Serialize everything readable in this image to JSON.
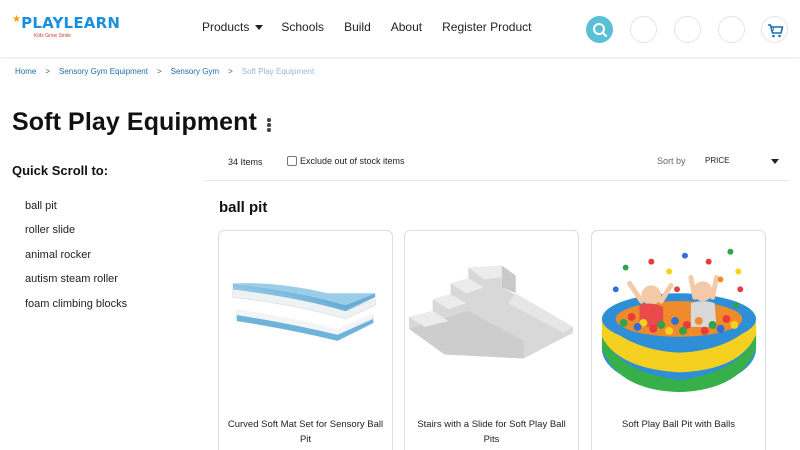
{
  "brand": {
    "name": "PLAYLEARN",
    "tagline": "Kids Grow Smile",
    "accent": "#1a8fdf",
    "search_color": "#5bbfd6"
  },
  "nav": {
    "items": [
      {
        "label": "Products",
        "has_dropdown": true
      },
      {
        "label": "Schools"
      },
      {
        "label": "Build"
      },
      {
        "label": "About"
      },
      {
        "label": "Register Product"
      }
    ]
  },
  "header_icons": [
    "search-icon",
    "account-icon",
    "wishlist-icon",
    "compare-icon",
    "cart-icon"
  ],
  "cart": {
    "count": "0"
  },
  "breadcrumb": [
    "Home",
    "Sensory Gym Equipment",
    "Sensory Gym",
    "Soft Play Equipment"
  ],
  "page": {
    "title": "Soft Play Equipment"
  },
  "sidebar": {
    "title": "Quick Scroll to:",
    "items": [
      "ball pit",
      "roller slide",
      "animal rocker",
      "autism steam roller",
      "foam climbing blocks"
    ]
  },
  "toolbar": {
    "items_count": "34 Items",
    "exclude_label": "Exclude out of stock items",
    "exclude_checked": false,
    "sort_label": "Sort by",
    "sort_value": "PRICE"
  },
  "section": {
    "title": "ball pit",
    "products": [
      {
        "name": "Curved Soft Mat Set for Sensory Ball Pit"
      },
      {
        "name": "Stairs with a Slide for Soft Play Ball Pits"
      },
      {
        "name": "Soft Play Ball Pit with Balls"
      }
    ]
  }
}
